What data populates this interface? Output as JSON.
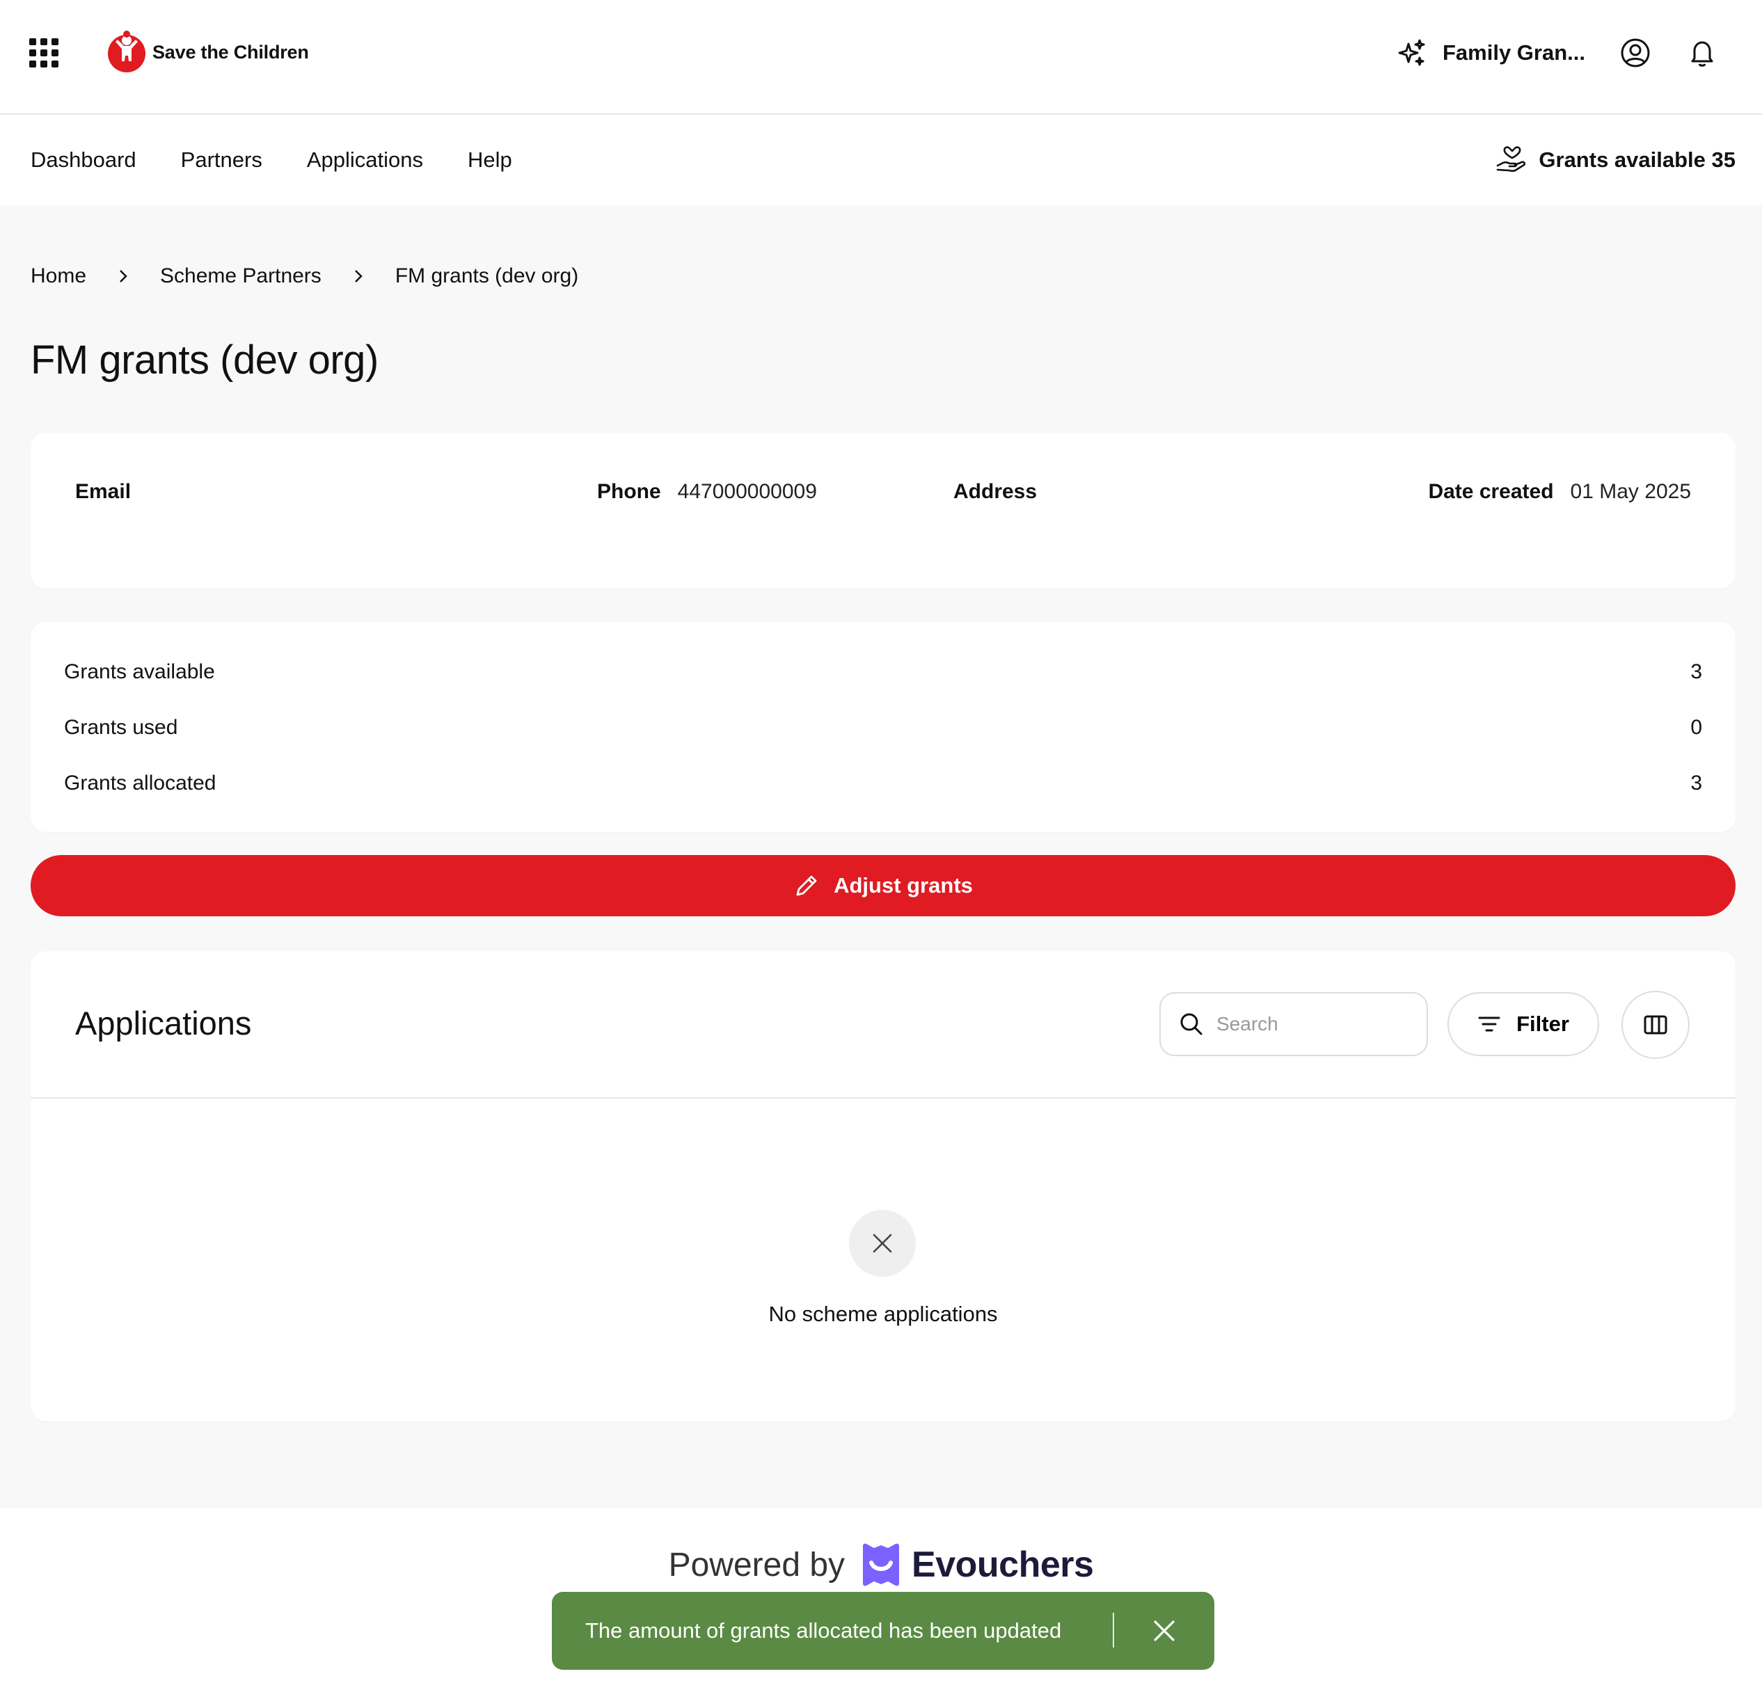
{
  "header": {
    "brand_name": "Save the Children",
    "scheme_name": "Family Gran...",
    "icons": [
      "apps-grid-icon",
      "sparkle-icon",
      "user-circle-icon",
      "bell-icon"
    ]
  },
  "nav": {
    "links": [
      "Dashboard",
      "Partners",
      "Applications",
      "Help"
    ],
    "grants_available_label": "Grants available 35"
  },
  "breadcrumb": [
    "Home",
    "Scheme Partners",
    "FM grants (dev org)"
  ],
  "page_title": "FM grants (dev org)",
  "info": {
    "email_label": "Email",
    "email_value": "",
    "phone_label": "Phone",
    "phone_value": "447000000009",
    "address_label": "Address",
    "address_value": "",
    "date_label": "Date created",
    "date_value": "01 May 2025"
  },
  "stats": [
    {
      "label": "Grants available",
      "value": "3"
    },
    {
      "label": "Grants used",
      "value": "0"
    },
    {
      "label": "Grants allocated",
      "value": "3"
    }
  ],
  "adjust_button": "Adjust grants",
  "applications": {
    "title": "Applications",
    "search_placeholder": "Search",
    "filter_label": "Filter",
    "empty_text": "No scheme applications"
  },
  "footer": {
    "powered_by": "Powered by",
    "brand": "Evouchers"
  },
  "toast": {
    "message": "The amount of grants allocated has been updated"
  },
  "colors": {
    "primary_red": "#e01b22",
    "toast_green": "#5a8a43",
    "evouchers_purple": "#7b61ff"
  }
}
